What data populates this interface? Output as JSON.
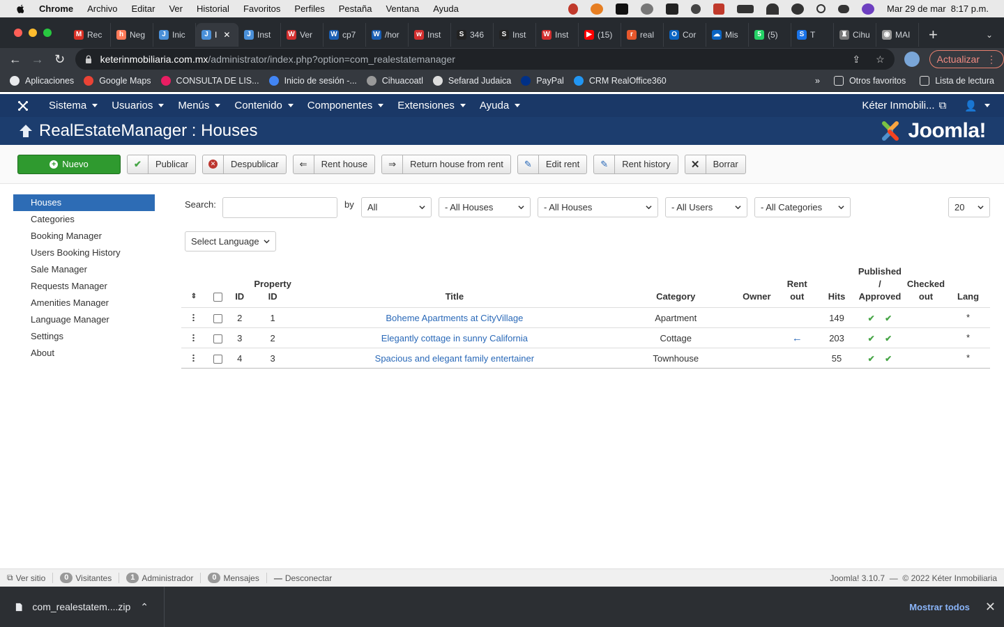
{
  "macos": {
    "menus": [
      "Chrome",
      "Archivo",
      "Editar",
      "Ver",
      "Historial",
      "Favoritos",
      "Perfiles",
      "Pestaña",
      "Ventana",
      "Ayuda"
    ],
    "clock": "Mar 29 de mar  8:17 p.m."
  },
  "browser": {
    "tabs": [
      {
        "label": "Rec",
        "color": "#d93025",
        "glyph": "M"
      },
      {
        "label": "Neg",
        "color": "#ff7a59",
        "glyph": "h"
      },
      {
        "label": "Inic",
        "color": "#4a90d9",
        "glyph": "J"
      },
      {
        "label": "I",
        "color": "#4a90d9",
        "glyph": "J",
        "active": true
      },
      {
        "label": "Inst",
        "color": "#4a90d9",
        "glyph": "J"
      },
      {
        "label": "Ver",
        "color": "#d32f2f",
        "glyph": "W"
      },
      {
        "label": "cp7",
        "color": "#1a5fb4",
        "glyph": "W"
      },
      {
        "label": "/hor",
        "color": "#1a5fb4",
        "glyph": "W"
      },
      {
        "label": "Inst",
        "color": "#d32f2f",
        "glyph": "w"
      },
      {
        "label": "346",
        "color": "#222",
        "glyph": "S"
      },
      {
        "label": "Inst",
        "color": "#222",
        "glyph": "S"
      },
      {
        "label": "Inst",
        "color": "#d32f2f",
        "glyph": "W"
      },
      {
        "label": "(15)",
        "color": "#ff0000",
        "glyph": "▶"
      },
      {
        "label": "real",
        "color": "#e6572c",
        "glyph": "r"
      },
      {
        "label": "Cor",
        "color": "#0a64c2",
        "glyph": "O"
      },
      {
        "label": "Mis",
        "color": "#0a64c2",
        "glyph": "☁"
      },
      {
        "label": "(5)",
        "color": "#25d366",
        "glyph": "5"
      },
      {
        "label": "T",
        "color": "#1a73e8",
        "glyph": "S"
      },
      {
        "label": "Cihu",
        "color": "#777",
        "glyph": "♜"
      },
      {
        "label": "MAI",
        "color": "#999",
        "glyph": "◉"
      }
    ],
    "url_host": "keterinmobiliaria.com.mx",
    "url_path": "/administrator/index.php?option=com_realestatemanager",
    "update_label": "Actualizar",
    "bookmarks": [
      {
        "label": "Aplicaciones",
        "color": "#e8eaed"
      },
      {
        "label": "Google Maps",
        "color": "#ea4335"
      },
      {
        "label": "CONSULTA DE LIS...",
        "color": "#e91e63"
      },
      {
        "label": "Inicio de sesión -...",
        "color": "#4285f4"
      },
      {
        "label": "Cihuacoatl",
        "color": "#999"
      },
      {
        "label": "Sefarad Judaica",
        "color": "#ddd"
      },
      {
        "label": "PayPal",
        "color": "#003087"
      },
      {
        "label": "CRM RealOffice360",
        "color": "#2196f3"
      }
    ],
    "bookmarks_right": [
      "Otros favoritos",
      "Lista de lectura"
    ]
  },
  "joomla": {
    "nav": [
      "Sistema",
      "Usuarios",
      "Menús",
      "Contenido",
      "Componentes",
      "Extensiones",
      "Ayuda"
    ],
    "site_name": "Kéter Inmobili...",
    "page_title": "RealEstateManager : Houses",
    "brand": "Joomla!",
    "toolbar": {
      "new": "Nuevo",
      "publish": "Publicar",
      "unpublish": "Despublicar",
      "rent": "Rent house",
      "return_rent": "Return house from rent",
      "edit_rent": "Edit rent",
      "rent_history": "Rent history",
      "delete": "Borrar"
    },
    "sidebar": [
      "Houses",
      "Categories",
      "Booking Manager",
      "Users Booking History",
      "Sale Manager",
      "Requests Manager",
      "Amenities Manager",
      "Language Manager",
      "Settings",
      "About"
    ],
    "filters": {
      "search_label": "Search:",
      "search_value": "",
      "by_label": "by",
      "by_value": "All",
      "houses1": "- All Houses",
      "houses2": "- All Houses",
      "users": "- All Users",
      "categories": "- All Categories",
      "limit": "20",
      "language": "Select Language"
    },
    "table": {
      "headers": {
        "id": "ID",
        "property_id_1": "Property",
        "property_id_2": "ID",
        "title": "Title",
        "category": "Category",
        "owner": "Owner",
        "rentout_1": "Rent",
        "rentout_2": "out",
        "hits": "Hits",
        "pub_1": "Published",
        "pub_2": "/",
        "pub_3": "Approved",
        "checked_1": "Checked",
        "checked_2": "out",
        "lang": "Lang"
      },
      "rows": [
        {
          "id": "2",
          "property_id": "1",
          "title": "Boheme Apartments at CityVillage",
          "category": "Apartment",
          "owner": "",
          "rent_out": "",
          "hits": "149",
          "lang": "*"
        },
        {
          "id": "3",
          "property_id": "2",
          "title": "Elegantly cottage in sunny California",
          "category": "Cottage",
          "owner": "",
          "rent_out": "←",
          "hits": "203",
          "lang": "*"
        },
        {
          "id": "4",
          "property_id": "3",
          "title": "Spacious and elegant family entertainer",
          "category": "Townhouse",
          "owner": "",
          "rent_out": "",
          "hits": "55",
          "lang": "*"
        }
      ]
    },
    "footer": {
      "view_site": "Ver sitio",
      "visitors_count": "0",
      "visitors": "Visitantes",
      "admins_count": "1",
      "admins": "Administrador",
      "messages_count": "0",
      "messages": "Mensajes",
      "logout": "Desconectar",
      "copyright": "Joomla! 3.10.7  —  © 2022 Kéter Inmobiliaria"
    }
  },
  "downloads": {
    "file": "com_realestatem....zip",
    "show_all": "Mostrar todos"
  },
  "colors": {
    "joomla_nav": "#1a3867",
    "header": "#1c3d6e",
    "active_sidebar": "#2d6cb5",
    "new_button": "#2f9a2f",
    "link": "#2a69b8",
    "ok": "#46a546"
  }
}
